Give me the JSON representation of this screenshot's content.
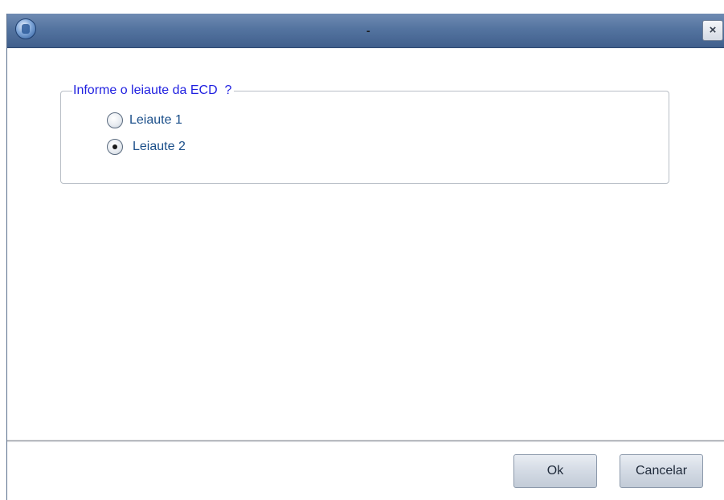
{
  "window": {
    "title": "-",
    "close_label": "×"
  },
  "group": {
    "legend": "Informe o leiaute da ECD  ?",
    "options": [
      {
        "label": "Leiaute 1",
        "checked": false
      },
      {
        "label": "Leiaute 2",
        "checked": true
      }
    ]
  },
  "footer": {
    "ok_label": "Ok",
    "cancel_label": "Cancelar"
  },
  "colors": {
    "titlebar": "#5474a0",
    "legend_text": "#1f1fe0",
    "option_text": "#1b4f8a"
  },
  "icons": {
    "app": "app-logo-icon",
    "close": "close-icon"
  }
}
